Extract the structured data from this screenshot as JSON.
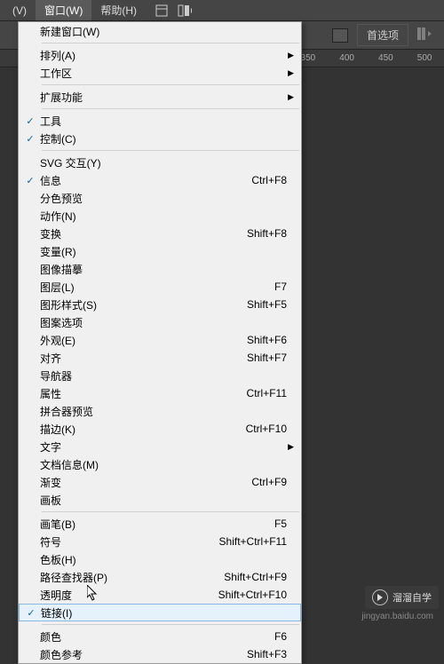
{
  "menubar": {
    "items": [
      {
        "label": "(V)"
      },
      {
        "label": "窗口(W)"
      },
      {
        "label": "帮助(H)"
      }
    ]
  },
  "toolbar": {
    "preferences": "首选项"
  },
  "ruler": {
    "marks": [
      "350",
      "400",
      "450",
      "500"
    ]
  },
  "dropdown": {
    "items": [
      {
        "label": "新建窗口(W)",
        "shortcut": "",
        "checked": false,
        "submenu": false
      },
      {
        "type": "sep"
      },
      {
        "label": "排列(A)",
        "shortcut": "",
        "checked": false,
        "submenu": true
      },
      {
        "label": "工作区",
        "shortcut": "",
        "checked": false,
        "submenu": true
      },
      {
        "type": "sep"
      },
      {
        "label": "扩展功能",
        "shortcut": "",
        "checked": false,
        "submenu": true
      },
      {
        "type": "sep"
      },
      {
        "label": "工具",
        "shortcut": "",
        "checked": true,
        "submenu": false
      },
      {
        "label": "控制(C)",
        "shortcut": "",
        "checked": true,
        "submenu": false
      },
      {
        "type": "sep"
      },
      {
        "label": "SVG 交互(Y)",
        "shortcut": "",
        "checked": false,
        "submenu": false
      },
      {
        "label": "信息",
        "shortcut": "Ctrl+F8",
        "checked": true,
        "submenu": false
      },
      {
        "label": "分色预览",
        "shortcut": "",
        "checked": false,
        "submenu": false
      },
      {
        "label": "动作(N)",
        "shortcut": "",
        "checked": false,
        "submenu": false
      },
      {
        "label": "变换",
        "shortcut": "Shift+F8",
        "checked": false,
        "submenu": false
      },
      {
        "label": "变量(R)",
        "shortcut": "",
        "checked": false,
        "submenu": false
      },
      {
        "label": "图像描摹",
        "shortcut": "",
        "checked": false,
        "submenu": false
      },
      {
        "label": "图层(L)",
        "shortcut": "F7",
        "checked": false,
        "submenu": false
      },
      {
        "label": "图形样式(S)",
        "shortcut": "Shift+F5",
        "checked": false,
        "submenu": false
      },
      {
        "label": "图案选项",
        "shortcut": "",
        "checked": false,
        "submenu": false
      },
      {
        "label": "外观(E)",
        "shortcut": "Shift+F6",
        "checked": false,
        "submenu": false
      },
      {
        "label": "对齐",
        "shortcut": "Shift+F7",
        "checked": false,
        "submenu": false
      },
      {
        "label": "导航器",
        "shortcut": "",
        "checked": false,
        "submenu": false
      },
      {
        "label": "属性",
        "shortcut": "Ctrl+F11",
        "checked": false,
        "submenu": false
      },
      {
        "label": "拼合器预览",
        "shortcut": "",
        "checked": false,
        "submenu": false
      },
      {
        "label": "描边(K)",
        "shortcut": "Ctrl+F10",
        "checked": false,
        "submenu": false
      },
      {
        "label": "文字",
        "shortcut": "",
        "checked": false,
        "submenu": true
      },
      {
        "label": "文档信息(M)",
        "shortcut": "",
        "checked": false,
        "submenu": false
      },
      {
        "label": "渐变",
        "shortcut": "Ctrl+F9",
        "checked": false,
        "submenu": false
      },
      {
        "label": "画板",
        "shortcut": "",
        "checked": false,
        "submenu": false
      },
      {
        "type": "sep"
      },
      {
        "label": "画笔(B)",
        "shortcut": "F5",
        "checked": false,
        "submenu": false
      },
      {
        "label": "符号",
        "shortcut": "Shift+Ctrl+F11",
        "checked": false,
        "submenu": false
      },
      {
        "label": "色板(H)",
        "shortcut": "",
        "checked": false,
        "submenu": false
      },
      {
        "label": "路径查找器(P)",
        "shortcut": "Shift+Ctrl+F9",
        "checked": false,
        "submenu": false
      },
      {
        "label": "透明度",
        "shortcut": "Shift+Ctrl+F10",
        "checked": false,
        "submenu": false
      },
      {
        "label": "链接(I)",
        "shortcut": "",
        "checked": true,
        "submenu": false,
        "hover": true
      },
      {
        "type": "sep"
      },
      {
        "label": "颜色",
        "shortcut": "F6",
        "checked": false,
        "submenu": false
      },
      {
        "label": "颜色参考",
        "shortcut": "Shift+F3",
        "checked": false,
        "submenu": false
      }
    ]
  },
  "watermark": {
    "title": "溜溜自学",
    "sub": "jingyan.baidu.com"
  }
}
